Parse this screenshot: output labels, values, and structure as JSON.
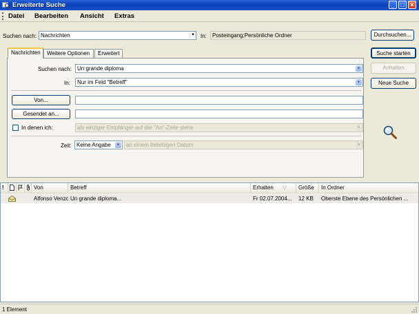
{
  "window": {
    "title": "Erweiterte Suche",
    "controls": {
      "minimize": "_",
      "maximize": "□",
      "close": "×"
    }
  },
  "menu": [
    "Datei",
    "Bearbeiten",
    "Ansicht",
    "Extras"
  ],
  "search": {
    "label": "Suchen nach:",
    "value": "Nachrichten",
    "in_label": "In:",
    "in_value": "Posteingang;Persönliche Ordner",
    "browse_button": "Durchsuchen..."
  },
  "actions": {
    "start": "Suche starten",
    "stop": "Anhalten",
    "new": "Neue Suche"
  },
  "tabs": [
    "Nachrichten",
    "Weitere Optionen",
    "Erweitert"
  ],
  "form": {
    "search_for_label": "Suchen nach:",
    "search_for_value": "Un grande diploma",
    "in_label": "In:",
    "in_value": "Nur im Feld \"Betreff\"",
    "from_button": "Von...",
    "from_value": "",
    "sent_to_button": "Gesendet an...",
    "sent_to_value": "",
    "where_label": "In denen ich:",
    "where_value": "als einziger Empfänger auf der \"An\"-Zeile stehe",
    "time_label": "Zeit:",
    "time_value": "Keine Angabe",
    "date_value": "an einem beliebigen Datum"
  },
  "results": {
    "columns": [
      "!",
      "Von",
      "Betreff",
      "Erhalten",
      "Größe",
      "In Ordner"
    ],
    "rows": [
      {
        "from": "Alfonso Venzo",
        "subject": "Un grande diploma...",
        "received": "Fr 02.07.2004...",
        "size": "12 KB",
        "folder": "Oberste Ebene des Persönlichen ..."
      }
    ]
  },
  "status": "1 Element",
  "colors": {
    "titlebar": "#0a3fb8",
    "window_bg": "#ece9d8",
    "tab_highlight": "#ffc73c",
    "field_border": "#7f9db9"
  },
  "icons": [
    "window-search-icon",
    "magnifier-icon",
    "importance-icon",
    "item-type-icon",
    "flag-icon",
    "attachment-icon",
    "envelope-open-icon"
  ]
}
